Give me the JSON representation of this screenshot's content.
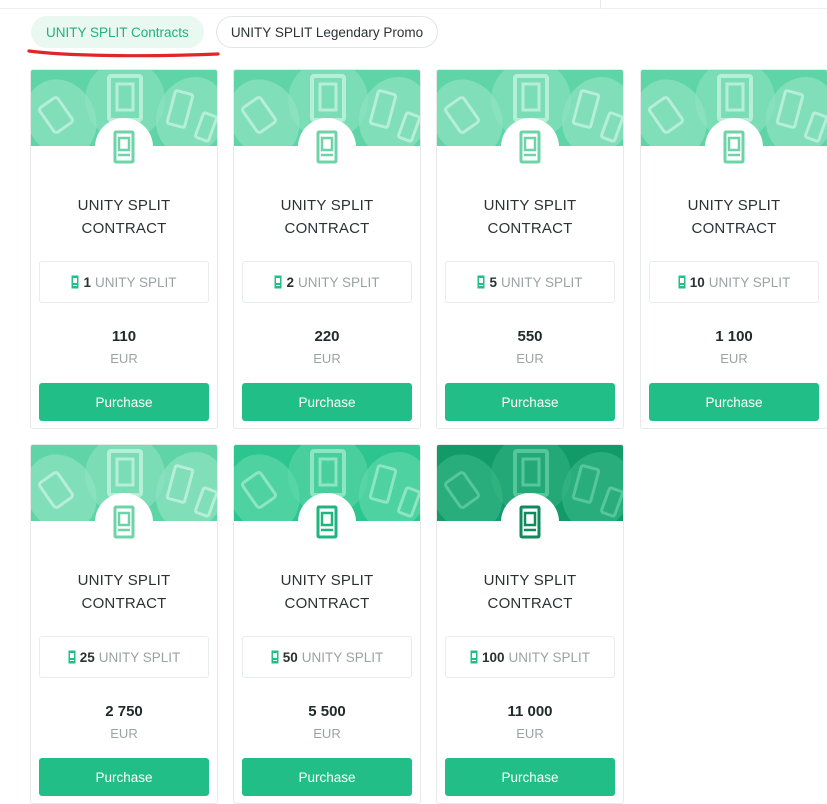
{
  "tabs": [
    {
      "label": "UNITY SPLIT Contracts",
      "active": true
    },
    {
      "label": "UNITY SPLIT Legendary Promo",
      "active": false
    }
  ],
  "cards": [
    {
      "title_line1": "UNITY SPLIT",
      "title_line2": "CONTRACT",
      "quantity": "1",
      "unit": "UNITY SPLIT",
      "price": "110",
      "currency": "EUR",
      "button": "Purchase",
      "tier": "light",
      "icon": "unity-split-token-icon"
    },
    {
      "title_line1": "UNITY SPLIT",
      "title_line2": "CONTRACT",
      "quantity": "2",
      "unit": "UNITY SPLIT",
      "price": "220",
      "currency": "EUR",
      "button": "Purchase",
      "tier": "light",
      "icon": "unity-split-token-icon"
    },
    {
      "title_line1": "UNITY SPLIT",
      "title_line2": "CONTRACT",
      "quantity": "5",
      "unit": "UNITY SPLIT",
      "price": "550",
      "currency": "EUR",
      "button": "Purchase",
      "tier": "light",
      "icon": "unity-split-token-icon"
    },
    {
      "title_line1": "UNITY SPLIT",
      "title_line2": "CONTRACT",
      "quantity": "10",
      "unit": "UNITY SPLIT",
      "price": "1 100",
      "currency": "EUR",
      "button": "Purchase",
      "tier": "light",
      "icon": "unity-split-token-icon"
    },
    {
      "title_line1": "UNITY SPLIT",
      "title_line2": "CONTRACT",
      "quantity": "25",
      "unit": "UNITY SPLIT",
      "price": "2 750",
      "currency": "EUR",
      "button": "Purchase",
      "tier": "light",
      "icon": "unity-split-token-icon"
    },
    {
      "title_line1": "UNITY SPLIT",
      "title_line2": "CONTRACT",
      "quantity": "50",
      "unit": "UNITY SPLIT",
      "price": "5 500",
      "currency": "EUR",
      "button": "Purchase",
      "tier": "medium",
      "icon": "unity-split-token-icon"
    },
    {
      "title_line1": "UNITY SPLIT",
      "title_line2": "CONTRACT",
      "quantity": "100",
      "unit": "UNITY SPLIT",
      "price": "11 000",
      "currency": "EUR",
      "button": "Purchase",
      "tier": "dark",
      "icon": "unity-split-token-icon"
    }
  ],
  "colors": {
    "accent": "#21bf87",
    "tab_active_bg": "#eaf8f2",
    "tab_active_text": "#22b07d",
    "annotation_underline": "#e0262b",
    "banner_light": "#5fd4a6",
    "banner_medium": "#2dc58f",
    "banner_dark": "#129a69"
  }
}
